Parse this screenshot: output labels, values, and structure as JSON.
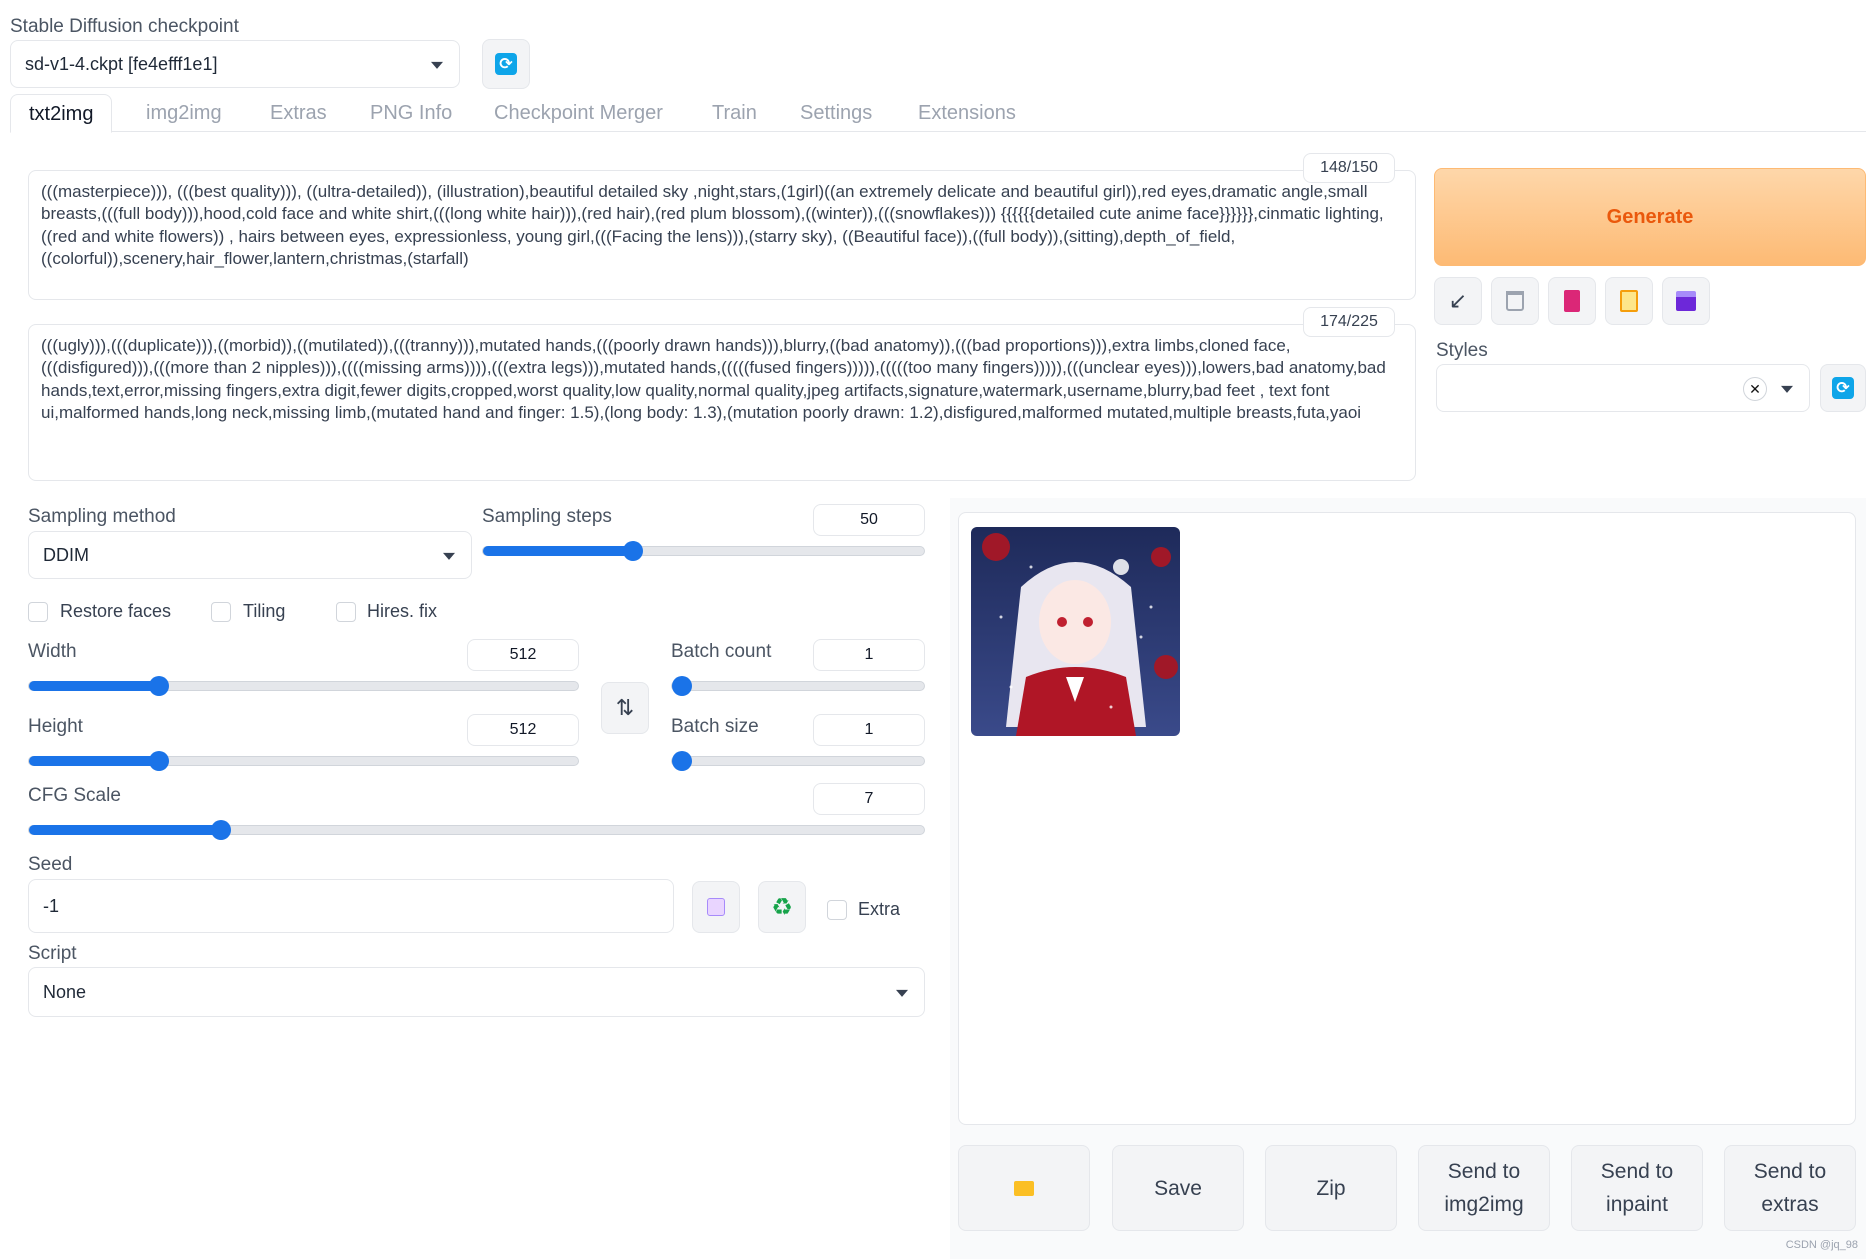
{
  "checkpoint": {
    "label": "Stable Diffusion checkpoint",
    "value": "sd-v1-4.ckpt [fe4efff1e1]"
  },
  "tabs": [
    {
      "label": "txt2img",
      "active": true
    },
    {
      "label": "img2img"
    },
    {
      "label": "Extras"
    },
    {
      "label": "PNG Info"
    },
    {
      "label": "Checkpoint Merger"
    },
    {
      "label": "Train"
    },
    {
      "label": "Settings"
    },
    {
      "label": "Extensions"
    }
  ],
  "prompt": {
    "counter": "148/150",
    "text": "(((masterpiece))), (((best quality))), ((ultra-detailed)), (illustration),beautiful detailed sky ,night,stars,(1girl)((an extremely delicate and beautiful girl)),red eyes,dramatic angle,small breasts,(((full body))),hood,cold face and white shirt,(((long white hair))),(red hair),(red plum blossom),((winter)),(((snowflakes))) {{{{{{detailed cute anime face}}}}}},cinmatic lighting,((red and white flowers)) ,   hairs between eyes, expressionless, young girl,(((Facing the lens))),(starry sky), ((Beautiful face)),((full body)),(sitting),depth_of_field,((colorful)),scenery,hair_flower,lantern,christmas,(starfall)"
  },
  "negative_prompt": {
    "counter": "174/225",
    "text": "(((ugly))),(((duplicate))),((morbid)),((mutilated)),(((tranny))),mutated hands,(((poorly drawn hands))),blurry,((bad anatomy)),(((bad proportions))),extra limbs,cloned face, (((disfigured))),(((more than 2 nipples))),((((missing arms)))),(((extra legs))),mutated hands,(((((fused fingers))))),(((((too many fingers))))),(((unclear eyes))),lowers,bad anatomy,bad hands,text,error,missing fingers,extra digit,fewer digits,cropped,worst quality,low quality,normal quality,jpeg artifacts,signature,watermark,username,blurry,bad feet ,   text font ui,malformed hands,long neck,missing limb,(mutated hand and finger: 1.5),(long body: 1.3),(mutation poorly drawn: 1.2),disfigured,malformed mutated,multiple breasts,futa,yaoi"
  },
  "generate_label": "Generate",
  "styles": {
    "label": "Styles",
    "clear": "✕"
  },
  "sampling": {
    "method_label": "Sampling method",
    "method_value": "DDIM",
    "steps_label": "Sampling steps",
    "steps_value": "50"
  },
  "checkboxes": {
    "restore_faces": "Restore faces",
    "tiling": "Tiling",
    "hires_fix": "Hires. fix",
    "extra": "Extra"
  },
  "width": {
    "label": "Width",
    "value": "512"
  },
  "height": {
    "label": "Height",
    "value": "512"
  },
  "batch_count": {
    "label": "Batch count",
    "value": "1"
  },
  "batch_size": {
    "label": "Batch size",
    "value": "1"
  },
  "cfg": {
    "label": "CFG Scale",
    "value": "7"
  },
  "seed": {
    "label": "Seed",
    "value": "-1"
  },
  "script": {
    "label": "Script",
    "value": "None"
  },
  "bottom_buttons": {
    "save": "Save",
    "zip": "Zip",
    "send_img2img": "Send to img2img",
    "send_inpaint": "Send to inpaint",
    "send_extras": "Send to extras"
  },
  "watermark": "CSDN @jq_98",
  "colors": {
    "accent": "#1a73e8",
    "generate": "#ea580c"
  }
}
